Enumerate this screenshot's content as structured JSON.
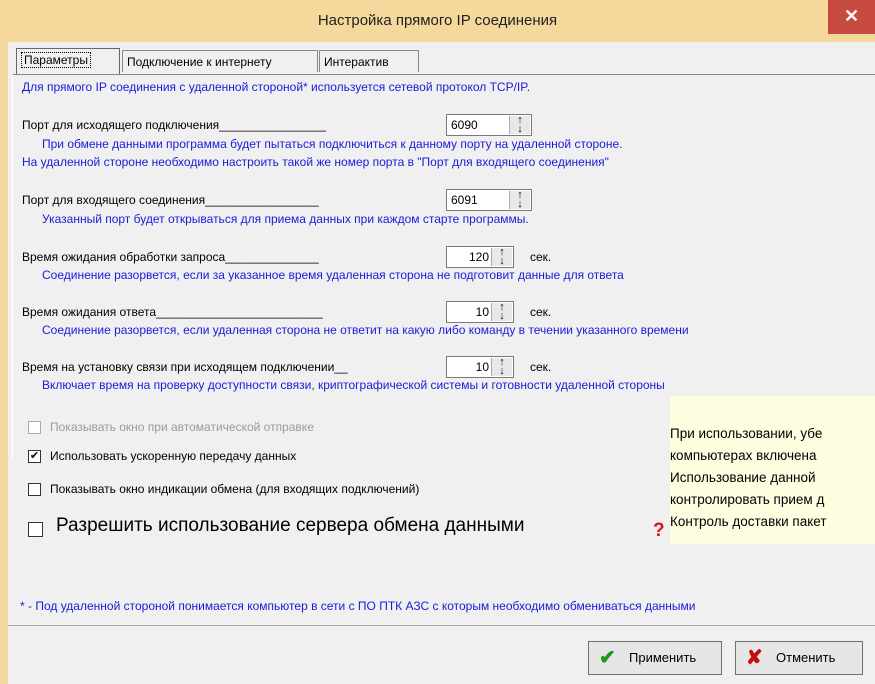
{
  "window": {
    "title": "Настройка прямого IP соединения",
    "close_glyph": "✕"
  },
  "tabs": [
    {
      "label": "Параметры"
    },
    {
      "label": "Подключение к интернету"
    },
    {
      "label": "Интерактив"
    }
  ],
  "intro": "Для прямого IP соединения с удаленной стороной* используется сетевой протокол TCP/IP.",
  "fields": [
    {
      "label": "Порт для исходящего подключения________________",
      "value": "6090",
      "unit": "",
      "hints": [
        "При обмене данными программа будет пытаться подключиться к данному порту на удаленной стороне.",
        "На удаленной стороне необходимо настроить такой же номер порта в \"Порт для входящего соединения\""
      ]
    },
    {
      "label": "Порт для входящего соединения_________________",
      "value": "6091",
      "unit": "",
      "hints": [
        "Указанный порт будет открываться для приема данных при каждом старте программы."
      ]
    },
    {
      "label": "Время ожидания обработки запроса______________",
      "value": "120",
      "unit": "сек.",
      "hints": [
        "Соединение разорвется, если за указанное время удаленная сторона не подготовит данные для ответа"
      ]
    },
    {
      "label": "Время ожидания ответа_________________________",
      "value": "10",
      "unit": "сек.",
      "hints": [
        "Соединение разорвется, если удаленная сторона не ответит на какую либо команду в течении указанного времени"
      ]
    },
    {
      "label": "Время на установку связи при исходящем подключении__",
      "value": "10",
      "unit": "сек.",
      "hints": [
        "Включает время на проверку доступности связи, криптографической системы и готовности удаленной стороны"
      ]
    }
  ],
  "checkboxes": [
    {
      "label": "Показывать окно при автоматической отправке",
      "checked": false,
      "disabled": true
    },
    {
      "label": "Использовать ускоренную передачу данных",
      "checked": true,
      "disabled": false
    },
    {
      "label": "Показывать окно индикации обмена (для входящих подключений)",
      "checked": false,
      "disabled": false
    },
    {
      "label": "Разрешить использование сервера обмена данными",
      "checked": false,
      "disabled": false
    }
  ],
  "note": {
    "lines": [
      "При использовании, убе",
      "компьютерах включена",
      "Использование данной",
      "контролировать прием д",
      "Контроль доставки пакет"
    ],
    "icon": "question-icon"
  },
  "footnote": "* - Под удаленной стороной понимается компьютер в сети с ПО ПТК АЗС с которым необходимо обмениваться данными",
  "buttons": {
    "apply": "Применить",
    "cancel": "Отменить"
  },
  "colors": {
    "title_bar": "#f5d89b",
    "close": "#c74a3f",
    "hint_text": "#1a1adb",
    "note_bg": "#fdfde0"
  }
}
